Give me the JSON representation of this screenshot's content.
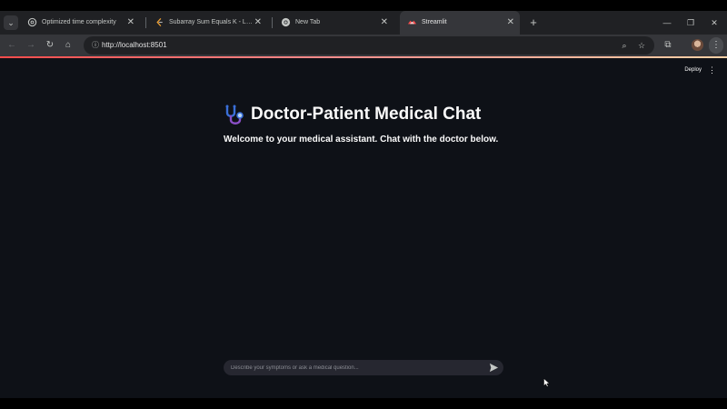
{
  "browser": {
    "tabs": [
      {
        "title": "Optimized time complexity",
        "active": false,
        "favicon": "openai-icon"
      },
      {
        "title": "Subarray Sum Equals K - LeetCode",
        "active": false,
        "favicon": "leetcode-icon"
      },
      {
        "title": "New Tab",
        "active": false,
        "favicon": "chrome-icon"
      },
      {
        "title": "Streamlit",
        "active": true,
        "favicon": "streamlit-icon"
      }
    ],
    "address_bar": {
      "url": "http://localhost:8501"
    }
  },
  "app": {
    "header": {
      "deploy_label": "Deploy"
    },
    "title": "Doctor-Patient Medical Chat",
    "title_icon": "stethoscope-icon",
    "subtitle": "Welcome to your medical assistant. Chat with the doctor below.",
    "chat_input": {
      "placeholder": "Describe your symptoms or ask a medical question...",
      "value": ""
    }
  },
  "colors": {
    "app_background": "#0e1117",
    "text": "#fafafa",
    "input_background": "#262730",
    "accent": "#ff4b4b",
    "browser_chrome": "#35363a",
    "tabstrip": "#202124"
  }
}
